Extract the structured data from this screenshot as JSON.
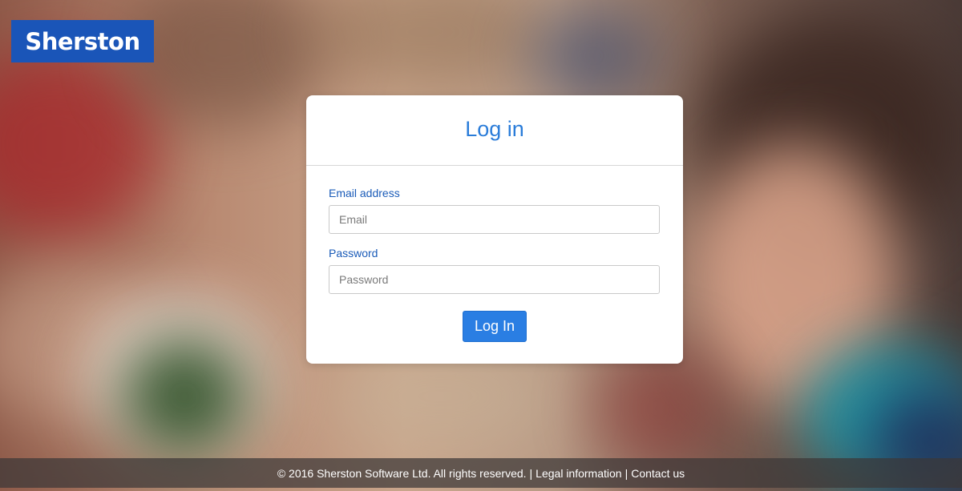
{
  "brand": {
    "logo_text": "Sherston",
    "color": "#1a55b8"
  },
  "login": {
    "title": "Log in",
    "email_label": "Email address",
    "email_placeholder": "Email",
    "email_value": "",
    "password_label": "Password",
    "password_placeholder": "Password",
    "password_value": "",
    "submit_label": "Log In",
    "accent_color": "#2a7ee3"
  },
  "footer": {
    "copyright": "© 2016 Sherston Software Ltd. All rights reserved.",
    "separator": "|",
    "legal_label": "Legal information",
    "contact_label": "Contact us"
  }
}
